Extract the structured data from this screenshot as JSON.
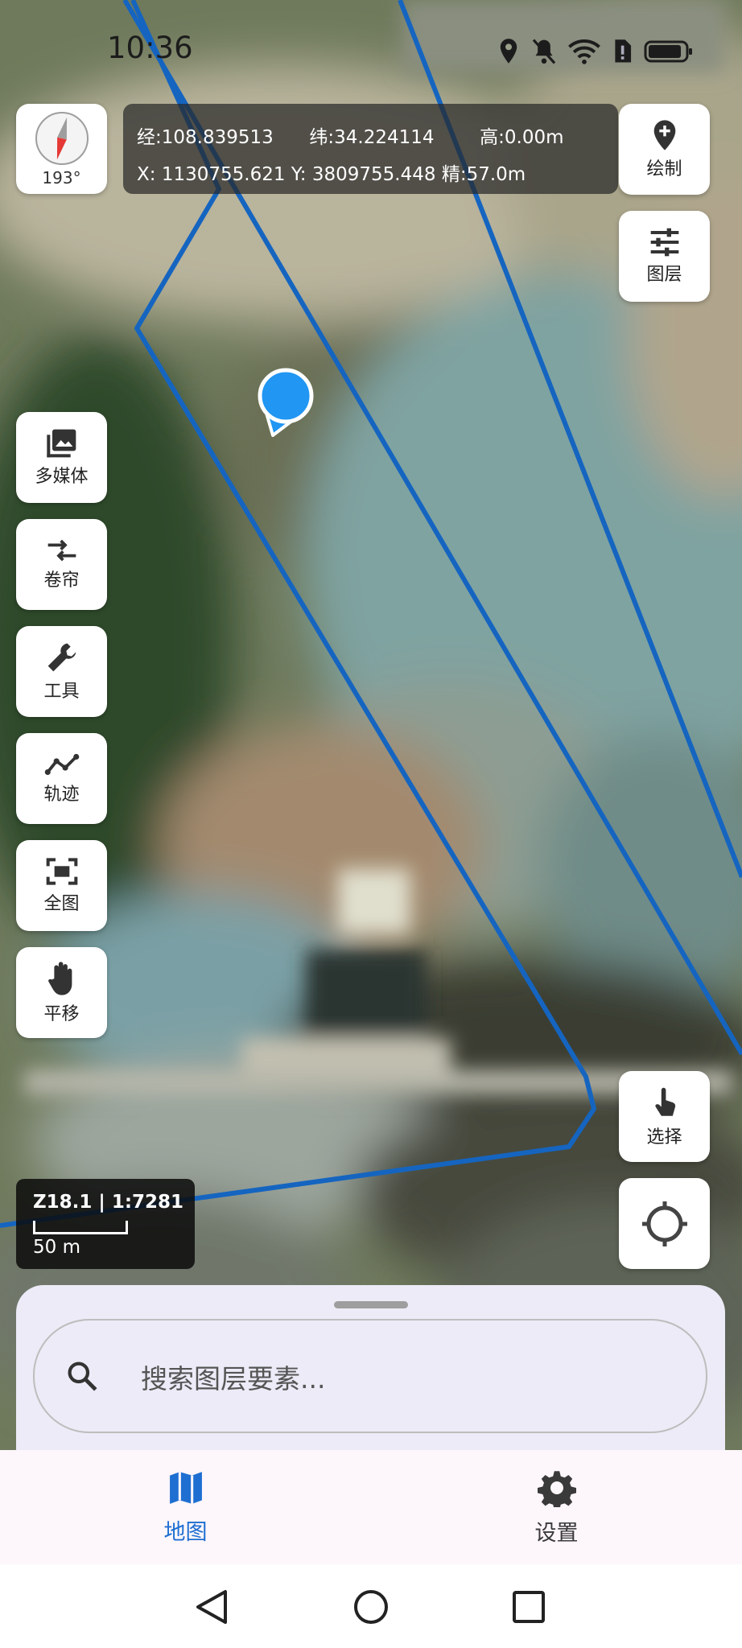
{
  "status_bar": {
    "time": "10:36"
  },
  "compass": {
    "heading": "193°"
  },
  "coordinates": {
    "lon_label": "经:",
    "lon": "108.839513",
    "lat_label": "纬:",
    "lat": "34.224114",
    "alt_label": "高:",
    "alt": "0.00m",
    "x_label": "X:",
    "x": "1130755.621",
    "y_label": "Y:",
    "y": "3809755.448",
    "acc_label": "精:",
    "acc": "57.0m"
  },
  "right_toolbar": {
    "draw_label": "绘制",
    "layers_label": "图层",
    "select_label": "选择"
  },
  "left_toolbar": [
    {
      "label": "多媒体",
      "icon": "image-icon"
    },
    {
      "label": "卷帘",
      "icon": "swap-arrows-icon"
    },
    {
      "label": "工具",
      "icon": "wrench-icon"
    },
    {
      "label": "轨迹",
      "icon": "track-line-icon"
    },
    {
      "label": "全图",
      "icon": "fullscreen-frame-icon"
    },
    {
      "label": "平移",
      "icon": "hand-icon"
    }
  ],
  "scale": {
    "zoom": "Z18.1 | 1:7281",
    "distance": "50 m"
  },
  "search": {
    "placeholder": "搜索图层要素..."
  },
  "bottom_nav": {
    "items": [
      {
        "label": "地图",
        "icon": "map-icon",
        "active": true
      },
      {
        "label": "设置",
        "icon": "gear-icon",
        "active": false
      }
    ],
    "active_color": "#1e6fd1",
    "inactive_color": "#3a3a3a"
  },
  "colors": {
    "boundary": "#1565c0",
    "location_marker": "#2196f3"
  }
}
